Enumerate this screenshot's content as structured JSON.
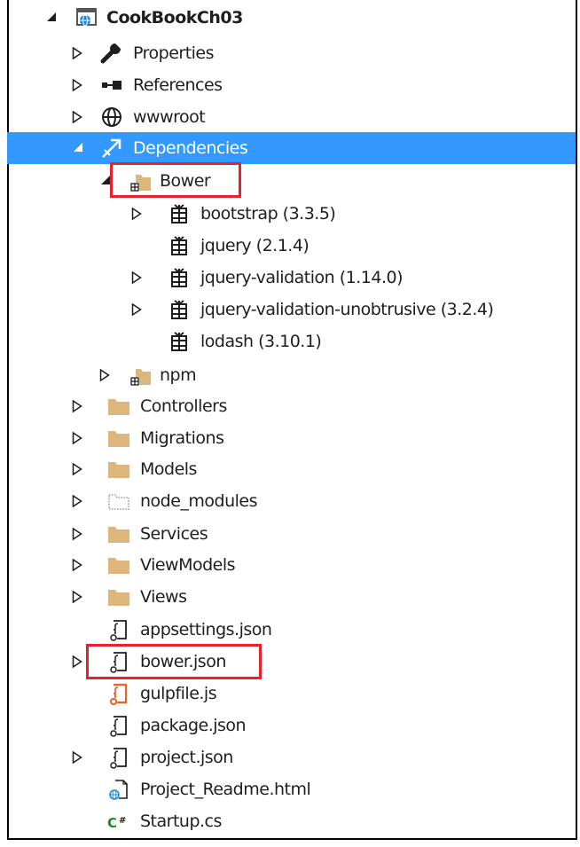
{
  "tree": {
    "root": {
      "label": "CookBookCh03",
      "icon": "web-project-icon",
      "expander": "expanded"
    },
    "items": [
      {
        "label": "Properties",
        "icon": "wrench-icon",
        "expander": "collapsed"
      },
      {
        "label": "References",
        "icon": "references-icon",
        "expander": "collapsed"
      },
      {
        "label": "wwwroot",
        "icon": "globe-icon",
        "expander": "collapsed"
      },
      {
        "label": "Dependencies",
        "icon": "dependencies-icon",
        "expander": "expanded",
        "selected": true
      },
      {
        "label": "Bower",
        "icon": "package-folder-icon",
        "expander": "expanded"
      },
      {
        "label": "bootstrap (3.3.5)",
        "icon": "package-icon",
        "expander": "collapsed"
      },
      {
        "label": "jquery (2.1.4)",
        "icon": "package-icon",
        "expander": "none"
      },
      {
        "label": "jquery-validation (1.14.0)",
        "icon": "package-icon",
        "expander": "collapsed"
      },
      {
        "label": "jquery-validation-unobtrusive (3.2.4)",
        "icon": "package-icon",
        "expander": "collapsed"
      },
      {
        "label": "lodash (3.10.1)",
        "icon": "package-icon",
        "expander": "none"
      },
      {
        "label": "npm",
        "icon": "package-folder-icon",
        "expander": "collapsed"
      },
      {
        "label": "Controllers",
        "icon": "folder-icon",
        "expander": "collapsed"
      },
      {
        "label": "Migrations",
        "icon": "folder-icon",
        "expander": "collapsed"
      },
      {
        "label": "Models",
        "icon": "folder-icon",
        "expander": "collapsed"
      },
      {
        "label": "node_modules",
        "icon": "dotted-folder-icon",
        "expander": "collapsed"
      },
      {
        "label": "Services",
        "icon": "folder-icon",
        "expander": "collapsed"
      },
      {
        "label": "ViewModels",
        "icon": "folder-icon",
        "expander": "collapsed"
      },
      {
        "label": "Views",
        "icon": "folder-icon",
        "expander": "collapsed"
      },
      {
        "label": "appsettings.json",
        "icon": "json-file-icon",
        "expander": "none"
      },
      {
        "label": "bower.json",
        "icon": "json-file-icon",
        "expander": "collapsed"
      },
      {
        "label": "gulpfile.js",
        "icon": "js-file-icon",
        "expander": "none"
      },
      {
        "label": "package.json",
        "icon": "json-file-icon",
        "expander": "none"
      },
      {
        "label": "project.json",
        "icon": "json-file-icon",
        "expander": "collapsed"
      },
      {
        "label": "Project_Readme.html",
        "icon": "html-file-icon",
        "expander": "none"
      },
      {
        "label": "Startup.cs",
        "icon": "csharp-file-icon",
        "expander": "none"
      }
    ]
  },
  "highlight_color": "#e8222a",
  "selection_color": "#3399ff"
}
